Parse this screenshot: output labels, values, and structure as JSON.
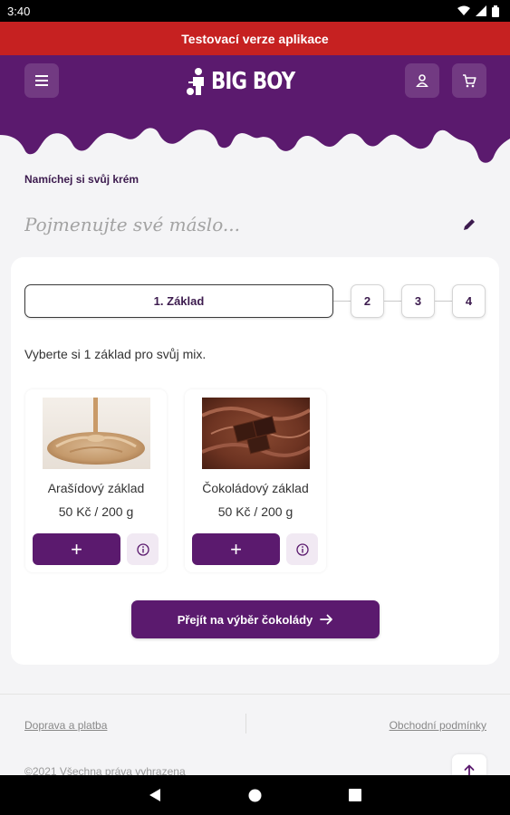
{
  "status_bar": {
    "time": "3:40"
  },
  "banner": {
    "text": "Testovací verze aplikace"
  },
  "header": {
    "logo_text": "BIG BOY",
    "brand_color": "#5b1a6e"
  },
  "page": {
    "title": "Namíchej si svůj krém",
    "name_placeholder": "Pojmenujte své máslo..."
  },
  "steps": {
    "active_label": "1. Základ",
    "others": [
      "2",
      "3",
      "4"
    ]
  },
  "instruction": "Vyberte si 1 základ pro svůj mix.",
  "products": [
    {
      "name": "Arašídový základ",
      "price": "50 Kč / 200 g",
      "add_label": "+",
      "image": "peanut-butter-image"
    },
    {
      "name": "Čokoládový základ",
      "price": "50 Kč / 200 g",
      "add_label": "+",
      "image": "chocolate-image"
    }
  ],
  "cta": {
    "label": "Přejít na výběr čokolády",
    "icon": "arrow-right-icon"
  },
  "footer": {
    "link_left": "Doprava a platba",
    "link_right": "Obchodní podmínky",
    "copyright": "©2021 Všechna práva vyhrazena"
  },
  "icons": [
    "menu-icon",
    "user-icon",
    "cart-icon",
    "edit-icon",
    "info-icon",
    "arrow-up-icon",
    "wifi-icon",
    "signal-icon",
    "battery-icon",
    "back-icon",
    "home-icon",
    "recents-icon"
  ]
}
